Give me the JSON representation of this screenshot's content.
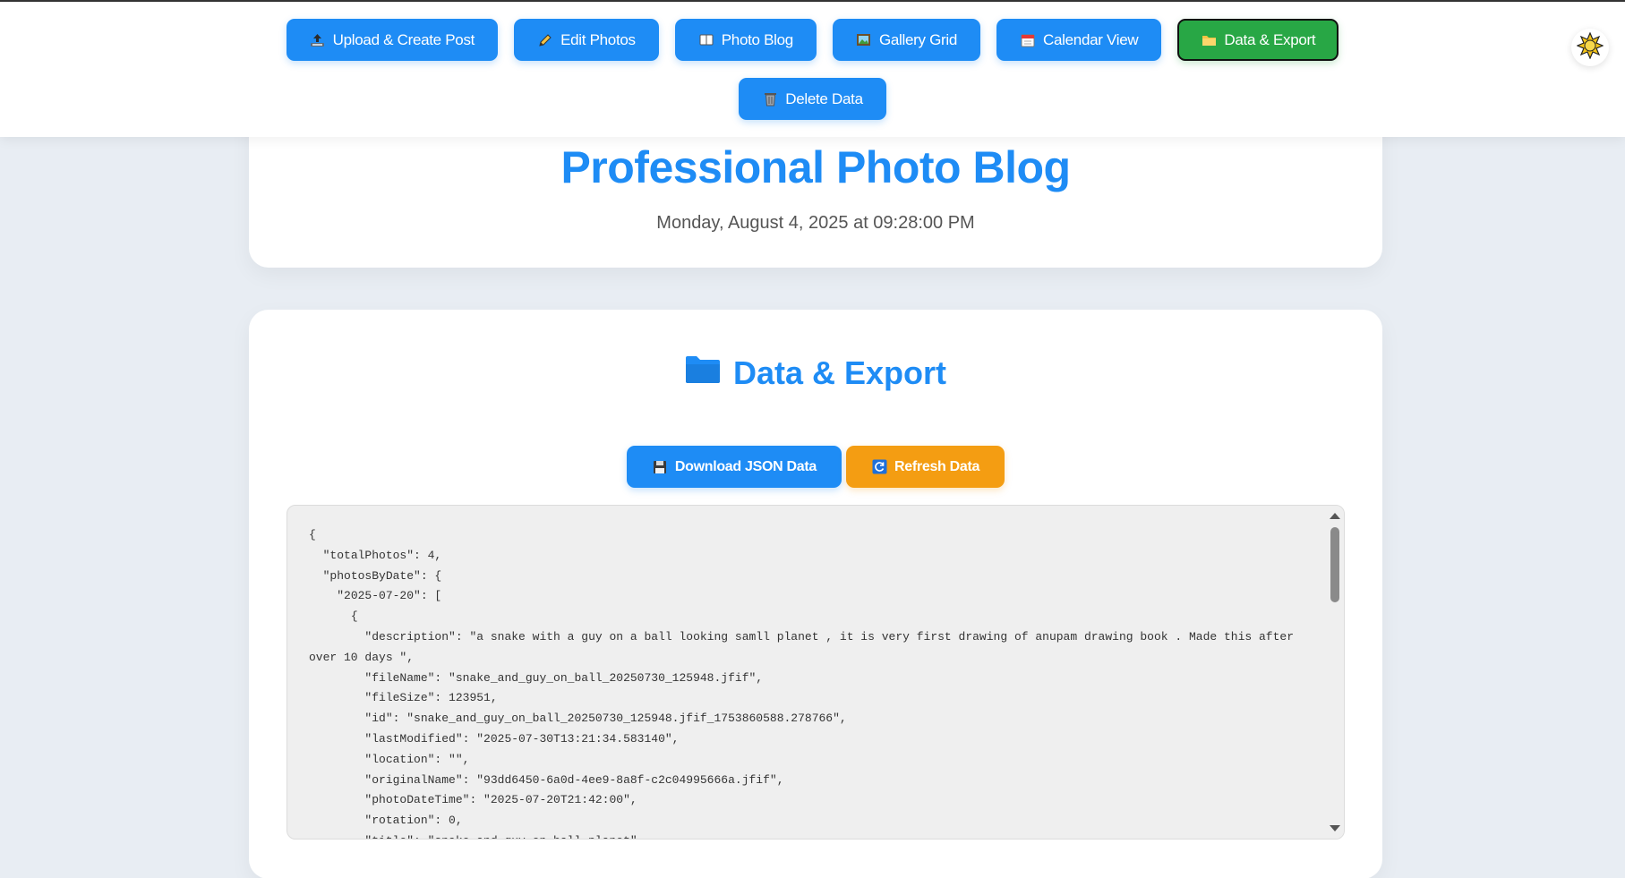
{
  "nav": {
    "items": [
      {
        "label": "Upload & Create Post",
        "icon": "upload-icon"
      },
      {
        "label": "Edit Photos",
        "icon": "pencil-icon"
      },
      {
        "label": "Photo Blog",
        "icon": "book-icon"
      },
      {
        "label": "Gallery Grid",
        "icon": "picture-icon"
      },
      {
        "label": "Calendar View",
        "icon": "calendar-icon"
      },
      {
        "label": "Data & Export",
        "icon": "folder-icon",
        "active": true
      },
      {
        "label": "Delete Data",
        "icon": "trash-icon"
      }
    ],
    "theme_toggle_icon": "sun-icon"
  },
  "header": {
    "title": "Professional Photo Blog",
    "date": "Monday, August 4, 2025 at 09:28:00 PM"
  },
  "export": {
    "title": "Data & Export",
    "title_icon": "folder-icon",
    "download_label": "Download JSON Data",
    "download_icon": "floppy-disk-icon",
    "refresh_label": "Refresh Data",
    "refresh_icon": "refresh-icon",
    "json_text": "{\n  \"totalPhotos\": 4,\n  \"photosByDate\": {\n    \"2025-07-20\": [\n      {\n        \"description\": \"a snake with a guy on a ball looking samll planet , it is very first drawing of anupam drawing book . Made this after over 10 days \",\n        \"fileName\": \"snake_and_guy_on_ball_20250730_125948.jfif\",\n        \"fileSize\": 123951,\n        \"id\": \"snake_and_guy_on_ball_20250730_125948.jfif_1753860588.278766\",\n        \"lastModified\": \"2025-07-30T13:21:34.583140\",\n        \"location\": \"\",\n        \"originalName\": \"93dd6450-6a0d-4ee9-8a8f-c2c04995666a.jfif\",\n        \"photoDateTime\": \"2025-07-20T21:42:00\",\n        \"rotation\": 0,\n        \"title\": \"snake and guy on ball planet\","
  },
  "colors": {
    "primary": "#1e8cf5",
    "active": "#28a745",
    "refresh": "#f49d12",
    "background": "#e8edf3"
  }
}
